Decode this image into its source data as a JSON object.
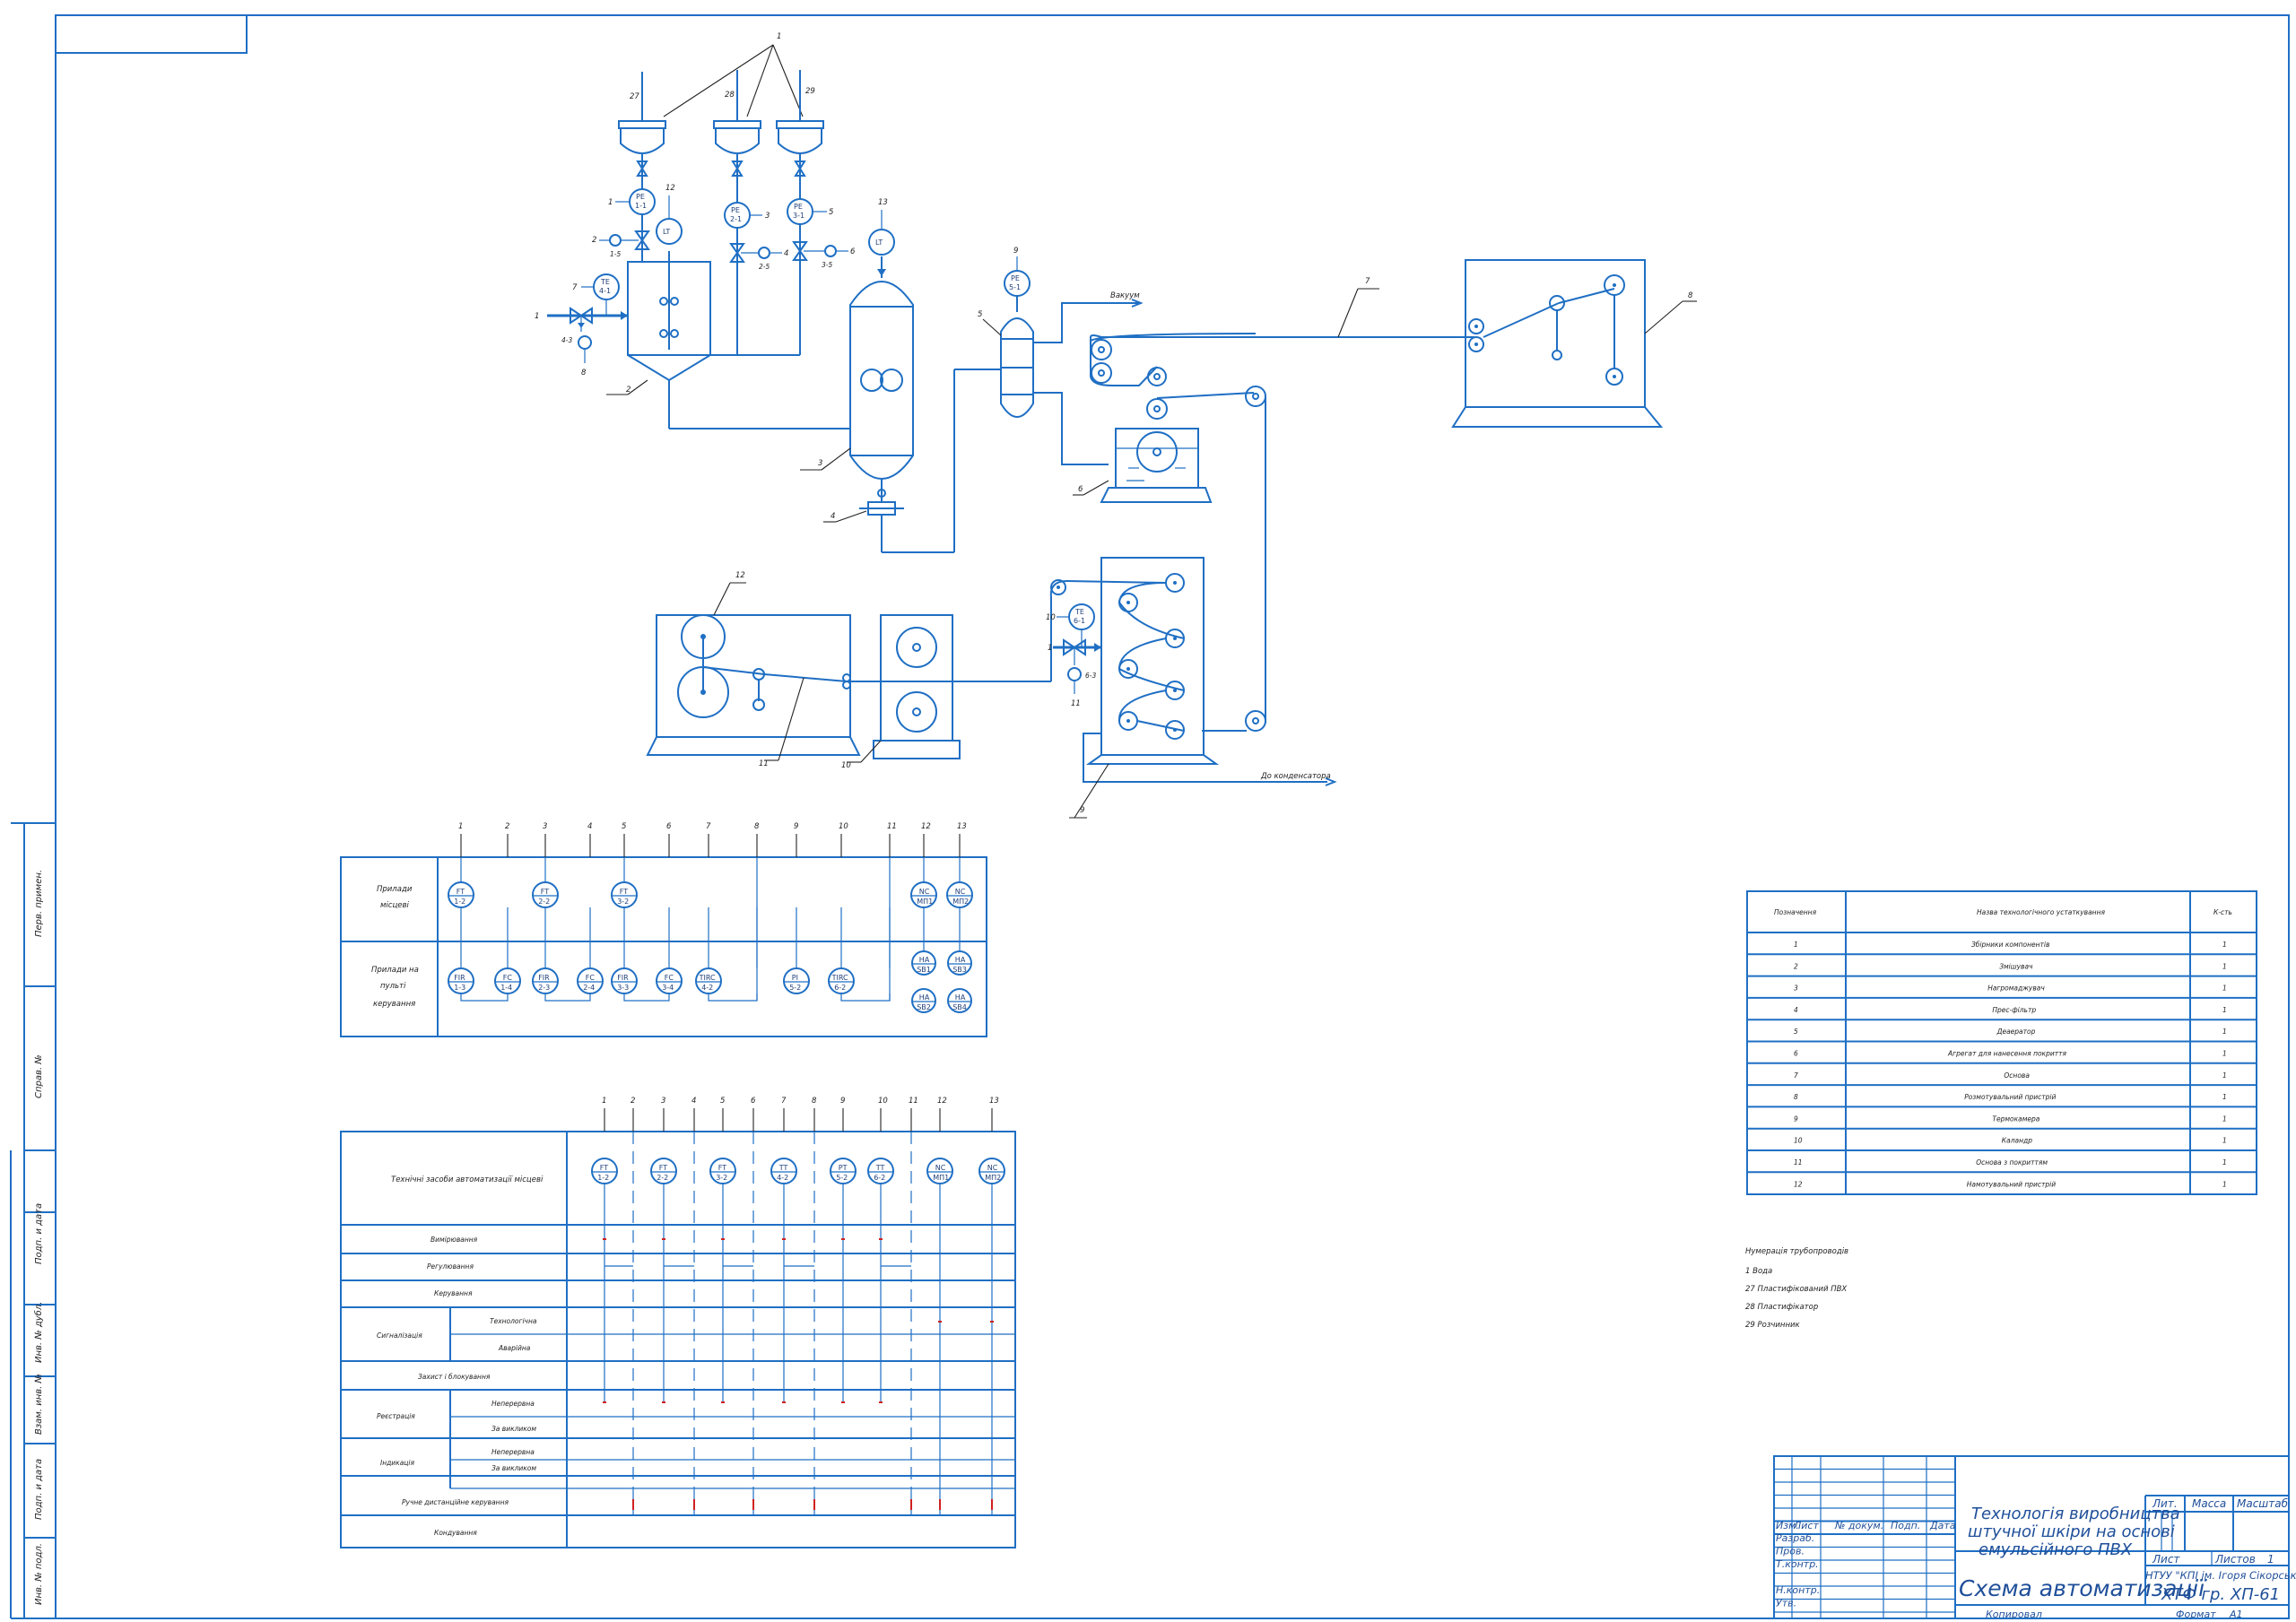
{
  "colors": {
    "line": "#1f6fc4",
    "accent_red": "#d02020",
    "text": "#222222"
  },
  "equipment_positions": [
    "1",
    "2",
    "3",
    "4",
    "5",
    "6",
    "7",
    "8",
    "9",
    "10",
    "11",
    "12",
    "13",
    "27",
    "28",
    "29"
  ],
  "pipe_labels": {
    "vacuum": "Вакуум",
    "to_condenser": "До конденсатора"
  },
  "instruments_p1": [
    {
      "id": "pe11",
      "top": "PE",
      "bot": "1-1"
    },
    {
      "id": "pe21",
      "top": "PE",
      "bot": "2-1"
    },
    {
      "id": "pe31",
      "top": "PE",
      "bot": "3-1"
    },
    {
      "id": "lt",
      "top": "LT",
      "bot": ""
    },
    {
      "id": "lt2",
      "top": "LT",
      "bot": ""
    },
    {
      "id": "te41",
      "top": "TE",
      "bot": "4-1"
    },
    {
      "id": "pe51",
      "top": "PE",
      "bot": "5-1"
    },
    {
      "id": "te61",
      "top": "TE",
      "bot": "6-1"
    }
  ],
  "side_labels": [
    "Перв. примен.",
    "Справ. №",
    "Подп. и дата",
    "Инв. № дубл.",
    "Взам. инв. №",
    "Подп. и дата",
    "Инв. № подл."
  ],
  "panel1": {
    "col_numbers": [
      "1",
      "2",
      "3",
      "4",
      "5",
      "6",
      "7",
      "8",
      "9",
      "10",
      "11",
      "12",
      "13"
    ],
    "row1_label": [
      "Прилади",
      "місцеві"
    ],
    "row2_label": [
      "Прилади на",
      "пульті",
      "керування"
    ],
    "row1_instr": [
      {
        "t": "FT",
        "b": "1-2"
      },
      {
        "t": "FT",
        "b": "2-2"
      },
      {
        "t": "FT",
        "b": "3-2"
      },
      {
        "t": "NC",
        "b": "МП1"
      },
      {
        "t": "NC",
        "b": "МП2"
      }
    ],
    "row2_instr": [
      {
        "t": "FIR",
        "b": "1-3"
      },
      {
        "t": "FC",
        "b": "1-4"
      },
      {
        "t": "FIR",
        "b": "2-3"
      },
      {
        "t": "FC",
        "b": "2-4"
      },
      {
        "t": "FIR",
        "b": "3-3"
      },
      {
        "t": "FC",
        "b": "3-4"
      },
      {
        "t": "TIRC",
        "b": "4-2"
      },
      {
        "t": "PI",
        "b": "5-2"
      },
      {
        "t": "TIRC",
        "b": "6-2"
      }
    ],
    "stations": [
      {
        "t": "НА",
        "b": "SB1"
      },
      {
        "t": "НА",
        "b": "SB3"
      },
      {
        "t": "НА",
        "b": "SB2"
      },
      {
        "t": "НА",
        "b": "SB4"
      }
    ]
  },
  "panel2": {
    "col_numbers": [
      "1",
      "2",
      "3",
      "4",
      "5",
      "6",
      "7",
      "8",
      "9",
      "10",
      "11",
      "12",
      "13"
    ],
    "header": "Технічні засоби автоматизації місцеві",
    "instr": [
      {
        "t": "FT",
        "b": "1-2"
      },
      {
        "t": "FT",
        "b": "2-2"
      },
      {
        "t": "FT",
        "b": "3-2"
      },
      {
        "t": "TT",
        "b": "4-2"
      },
      {
        "t": "PT",
        "b": "5-2"
      },
      {
        "t": "TT",
        "b": "6-2"
      },
      {
        "t": "NC",
        "b": "МП1"
      },
      {
        "t": "NC",
        "b": "МП2"
      }
    ],
    "rows": [
      "Вимірювання",
      "Регулювання",
      "Керування",
      "Технологічна",
      "Аварійна",
      "Захист і блокування",
      "Неперервна",
      "За викликом",
      "Неперервна",
      "За викликом",
      "Ручне дистанційне керування",
      "Кондування"
    ],
    "groups": [
      "Сигналізація",
      "Реєстрація",
      "Індикація"
    ]
  },
  "spec_table": {
    "headers": [
      "Позначення",
      "Назва технологічного устаткування",
      "К-сть"
    ],
    "rows": [
      [
        "1",
        "Збірники компонентів",
        "1"
      ],
      [
        "2",
        "Змішувач",
        "1"
      ],
      [
        "3",
        "Нагромаджувач",
        "1"
      ],
      [
        "4",
        "Прес-фільтр",
        "1"
      ],
      [
        "5",
        "Деаератор",
        "1"
      ],
      [
        "6",
        "Агрегат для нанесення покриття",
        "1"
      ],
      [
        "7",
        "Основа",
        "1"
      ],
      [
        "8",
        "Розмотувальний пристрій",
        "1"
      ],
      [
        "9",
        "Термокамера",
        "1"
      ],
      [
        "10",
        "Каландр",
        "1"
      ],
      [
        "11",
        "Основа з покриттям",
        "1"
      ],
      [
        "12",
        "Намотувальний пристрій",
        "1"
      ]
    ]
  },
  "pipeline_notes": {
    "title": "Нумерація трубопроводів",
    "items": [
      "1  Вода",
      "27 Пластифікований ПВХ",
      "28 Пластифікатор",
      "29 Розчинник"
    ]
  },
  "title_block": {
    "hdr": [
      "Изм.",
      "Лист",
      "№ докум.",
      "Подп.",
      "Дата"
    ],
    "roles": [
      "Разраб.",
      "Пров.",
      "Т.контр.",
      "",
      "Н.контр.",
      "Утв."
    ],
    "title_line1": "Технологія виробництва",
    "title_line2": "штучної шкіри на основі",
    "title_line3": "емульсійного ПВХ",
    "drawing_name": "Схема автоматизації",
    "col_lit": "Лит.",
    "col_mass": "Масса",
    "col_scale": "Масштаб",
    "sheet": "Лист",
    "sheets": "Листов",
    "sheets_count": "1",
    "org1": "НТУУ \"КПІ ім. Ігоря Сікорського\"",
    "org2": "ХТФ  гр. ХП-61",
    "copied": "Копировал",
    "format": "Формат",
    "format_val": "А1"
  }
}
